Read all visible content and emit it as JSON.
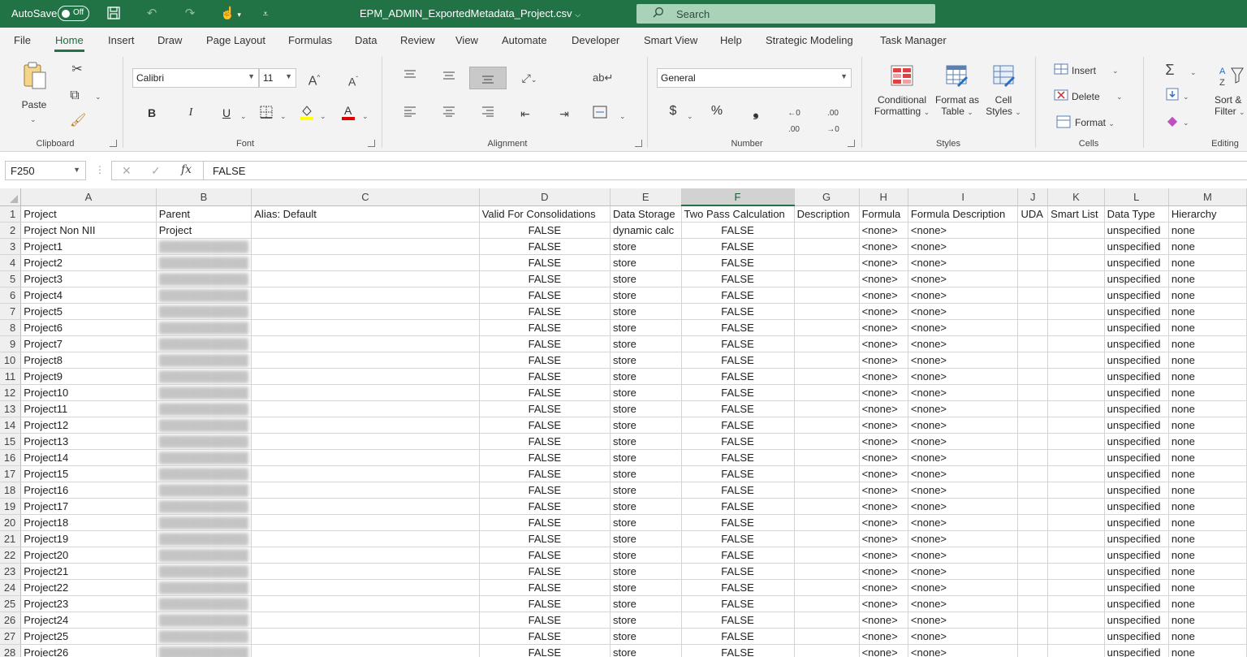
{
  "titlebar": {
    "autosave_label": "AutoSave",
    "autosave_state": "Off",
    "filename": "EPM_ADMIN_ExportedMetadata_Project.csv",
    "search_placeholder": "Search"
  },
  "tabs": [
    "File",
    "Home",
    "Insert",
    "Draw",
    "Page Layout",
    "Formulas",
    "Data",
    "Review",
    "View",
    "Automate",
    "Developer",
    "Smart View",
    "Help",
    "Strategic Modeling",
    "Task Manager"
  ],
  "active_tab": "Home",
  "ribbon": {
    "clipboard": {
      "paste": "Paste",
      "label": "Clipboard"
    },
    "font": {
      "name": "Calibri",
      "size": "11",
      "bold": "B",
      "italic": "I",
      "underline": "U",
      "label": "Font"
    },
    "alignment": {
      "label": "Alignment"
    },
    "number": {
      "format": "General",
      "currency": "$",
      "percent": "%",
      "comma": "❟",
      "label": "Number"
    },
    "styles": {
      "conditional_1": "Conditional",
      "conditional_2": "Formatting",
      "format_table_1": "Format as",
      "format_table_2": "Table",
      "cell_styles_1": "Cell",
      "cell_styles_2": "Styles",
      "label": "Styles"
    },
    "cells": {
      "insert": "Insert",
      "delete": "Delete",
      "format": "Format",
      "label": "Cells"
    },
    "editing": {
      "sort_1": "Sort &",
      "sort_2": "Filter",
      "label": "Editing"
    }
  },
  "formula_bar": {
    "name_box": "F250",
    "fx": "fx",
    "value": "FALSE"
  },
  "grid": {
    "columns": [
      "A",
      "B",
      "C",
      "D",
      "E",
      "F",
      "G",
      "H",
      "I",
      "J",
      "K",
      "L",
      "M"
    ],
    "selected_column": "F",
    "header_row": [
      "Project",
      "Parent",
      "Alias: Default",
      "Valid For Consolidations",
      "Data Storage",
      "Two Pass Calculation",
      "Description",
      "Formula",
      "Formula Description",
      "UDA",
      "Smart List",
      "Data Type",
      "Hierarchy"
    ],
    "row2": [
      "Project Non NII",
      "Project",
      "",
      "FALSE",
      "dynamic calc",
      "FALSE",
      "",
      "<none>",
      "<none>",
      "",
      "",
      "unspecified",
      "none"
    ],
    "data_rows": [
      [
        "Project1",
        "FALSE",
        "store",
        "FALSE",
        "<none>",
        "<none>",
        "unspecified",
        "none"
      ],
      [
        "Project2",
        "FALSE",
        "store",
        "FALSE",
        "<none>",
        "<none>",
        "unspecified",
        "none"
      ],
      [
        "Project3",
        "FALSE",
        "store",
        "FALSE",
        "<none>",
        "<none>",
        "unspecified",
        "none"
      ],
      [
        "Project4",
        "FALSE",
        "store",
        "FALSE",
        "<none>",
        "<none>",
        "unspecified",
        "none"
      ],
      [
        "Project5",
        "FALSE",
        "store",
        "FALSE",
        "<none>",
        "<none>",
        "unspecified",
        "none"
      ],
      [
        "Project6",
        "FALSE",
        "store",
        "FALSE",
        "<none>",
        "<none>",
        "unspecified",
        "none"
      ],
      [
        "Project7",
        "FALSE",
        "store",
        "FALSE",
        "<none>",
        "<none>",
        "unspecified",
        "none"
      ],
      [
        "Project8",
        "FALSE",
        "store",
        "FALSE",
        "<none>",
        "<none>",
        "unspecified",
        "none"
      ],
      [
        "Project9",
        "FALSE",
        "store",
        "FALSE",
        "<none>",
        "<none>",
        "unspecified",
        "none"
      ],
      [
        "Project10",
        "FALSE",
        "store",
        "FALSE",
        "<none>",
        "<none>",
        "unspecified",
        "none"
      ],
      [
        "Project11",
        "FALSE",
        "store",
        "FALSE",
        "<none>",
        "<none>",
        "unspecified",
        "none"
      ],
      [
        "Project12",
        "FALSE",
        "store",
        "FALSE",
        "<none>",
        "<none>",
        "unspecified",
        "none"
      ],
      [
        "Project13",
        "FALSE",
        "store",
        "FALSE",
        "<none>",
        "<none>",
        "unspecified",
        "none"
      ],
      [
        "Project14",
        "FALSE",
        "store",
        "FALSE",
        "<none>",
        "<none>",
        "unspecified",
        "none"
      ],
      [
        "Project15",
        "FALSE",
        "store",
        "FALSE",
        "<none>",
        "<none>",
        "unspecified",
        "none"
      ],
      [
        "Project16",
        "FALSE",
        "store",
        "FALSE",
        "<none>",
        "<none>",
        "unspecified",
        "none"
      ],
      [
        "Project17",
        "FALSE",
        "store",
        "FALSE",
        "<none>",
        "<none>",
        "unspecified",
        "none"
      ],
      [
        "Project18",
        "FALSE",
        "store",
        "FALSE",
        "<none>",
        "<none>",
        "unspecified",
        "none"
      ],
      [
        "Project19",
        "FALSE",
        "store",
        "FALSE",
        "<none>",
        "<none>",
        "unspecified",
        "none"
      ],
      [
        "Project20",
        "FALSE",
        "store",
        "FALSE",
        "<none>",
        "<none>",
        "unspecified",
        "none"
      ],
      [
        "Project21",
        "FALSE",
        "store",
        "FALSE",
        "<none>",
        "<none>",
        "unspecified",
        "none"
      ],
      [
        "Project22",
        "FALSE",
        "store",
        "FALSE",
        "<none>",
        "<none>",
        "unspecified",
        "none"
      ],
      [
        "Project23",
        "FALSE",
        "store",
        "FALSE",
        "<none>",
        "<none>",
        "unspecified",
        "none"
      ],
      [
        "Project24",
        "FALSE",
        "store",
        "FALSE",
        "<none>",
        "<none>",
        "unspecified",
        "none"
      ],
      [
        "Project25",
        "FALSE",
        "store",
        "FALSE",
        "<none>",
        "<none>",
        "unspecified",
        "none"
      ],
      [
        "Project26",
        "FALSE",
        "store",
        "FALSE",
        "<none>",
        "<none>",
        "unspecified",
        "none"
      ]
    ]
  },
  "colors": {
    "accent": "#217346",
    "search_bg": "#a9d3b8",
    "ribbon_bg": "#f3f3f3"
  }
}
